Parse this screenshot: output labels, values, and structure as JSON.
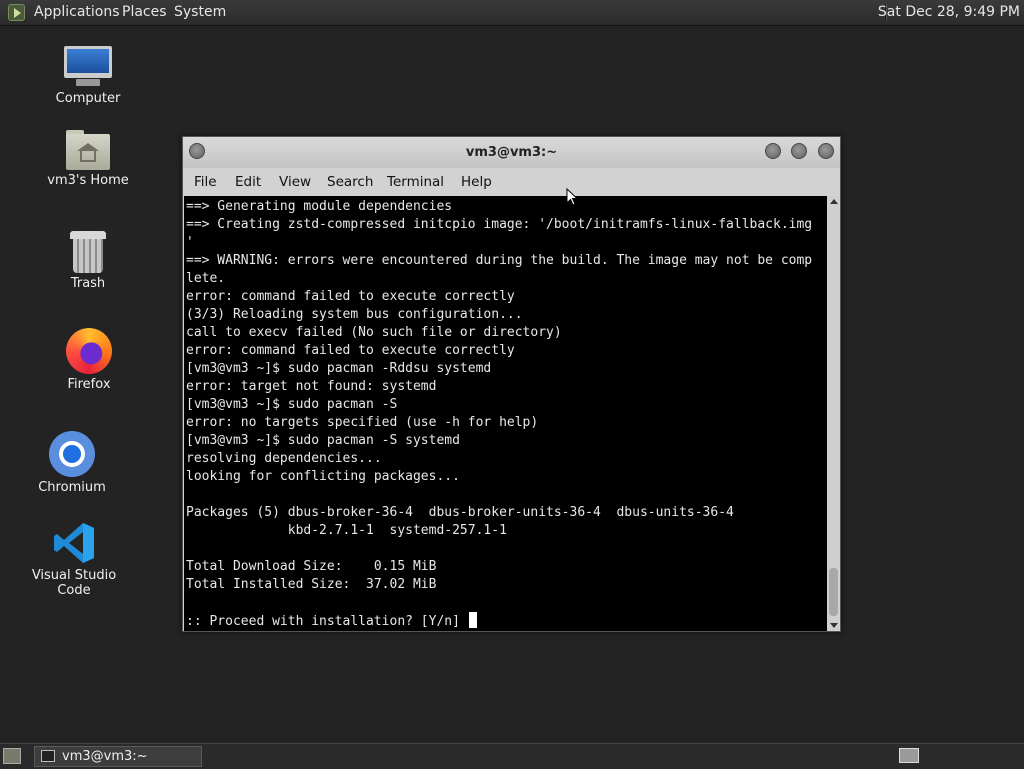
{
  "top_panel": {
    "menus": [
      "Applications",
      "Places",
      "System"
    ],
    "clock": "Sat Dec 28,  9:49 PM"
  },
  "desktop_icons": [
    {
      "label": "Computer",
      "icon": "computer-icon"
    },
    {
      "label": "vm3's Home",
      "icon": "home-folder-icon"
    },
    {
      "label": "Trash",
      "icon": "trash-icon"
    },
    {
      "label": "Firefox",
      "icon": "firefox-icon"
    },
    {
      "label": "Chromium",
      "icon": "chromium-icon"
    },
    {
      "label": "Visual Studio Code",
      "icon": "vscode-icon"
    }
  ],
  "terminal": {
    "title": "vm3@vm3:~",
    "menu": [
      "File",
      "Edit",
      "View",
      "Search",
      "Terminal",
      "Help"
    ],
    "lines": [
      "==> Generating module dependencies",
      "==> Creating zstd-compressed initcpio image: '/boot/initramfs-linux-fallback.img",
      "'",
      "==> WARNING: errors were encountered during the build. The image may not be comp",
      "lete.",
      "error: command failed to execute correctly",
      "(3/3) Reloading system bus configuration...",
      "call to execv failed (No such file or directory)",
      "error: command failed to execute correctly",
      "[vm3@vm3 ~]$ sudo pacman -Rddsu systemd",
      "error: target not found: systemd",
      "[vm3@vm3 ~]$ sudo pacman -S",
      "error: no targets specified (use -h for help)",
      "[vm3@vm3 ~]$ sudo pacman -S systemd",
      "resolving dependencies...",
      "looking for conflicting packages...",
      "",
      "Packages (5) dbus-broker-36-4  dbus-broker-units-36-4  dbus-units-36-4",
      "             kbd-2.7.1-1  systemd-257.1-1",
      "",
      "Total Download Size:    0.15 MiB",
      "Total Installed Size:  37.02 MiB",
      "",
      ":: Proceed with installation? [Y/n] "
    ]
  },
  "taskbar": {
    "window_label": "vm3@vm3:~"
  }
}
